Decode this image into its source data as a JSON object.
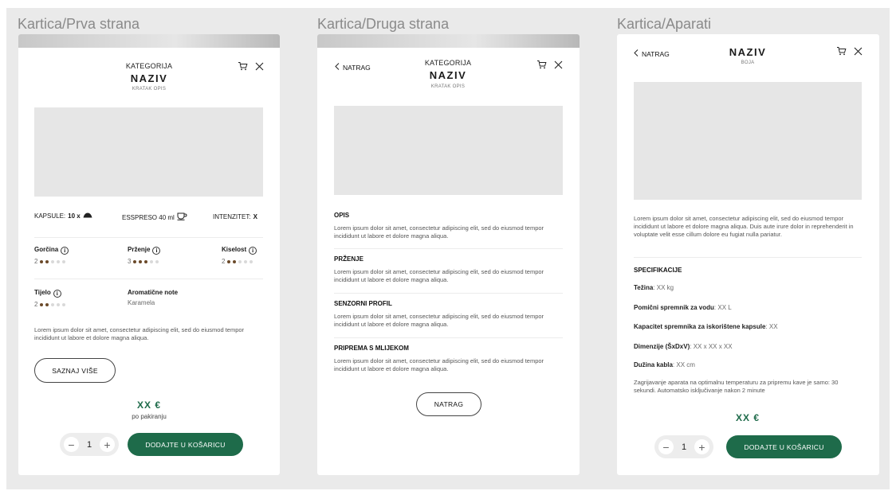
{
  "frames": {
    "prva": "Kartica/Prva strana",
    "druga": "Kartica/Druga strana",
    "aparati": "Kartica/Aparati"
  },
  "card1": {
    "kategorija": "KATEGORIJA",
    "naziv": "NAZIV",
    "kratak_opis": "KRATAK OPIS",
    "kapsule_label": "KAPSULE:",
    "kapsule_value": "10 x",
    "espreso": "ESSPRESO 40 ml",
    "intenzitet_label": "INTENZITET:",
    "intenzitet_value": "X",
    "gorcina": {
      "label": "Gorčina",
      "value": "2",
      "level": 2
    },
    "przenje": {
      "label": "Prženje",
      "value": "3",
      "level": 3
    },
    "kiselost": {
      "label": "Kiselost",
      "value": "2",
      "level": 2
    },
    "tijelo": {
      "label": "Tijelo",
      "value": "2",
      "level": 2
    },
    "aromaticne_label": "Aromatične note",
    "aromaticne_value": "Karamela",
    "description": "Lorem ipsum dolor sit amet, consectetur adipiscing elit, sed do eiusmod tempor incididunt ut labore et dolore magna aliqua.",
    "saznaj": "SAZNAJ VIŠE",
    "price": "XX €",
    "per": "po pakiranju",
    "qty": "1",
    "add": "DODAJTE U KOŠARICU"
  },
  "card2": {
    "back": "NATRAG",
    "kategorija": "KATEGORIJA",
    "naziv": "NAZIV",
    "kratak_opis": "KRATAK OPIS",
    "sections": [
      {
        "title": "OPIS",
        "text": "Lorem ipsum dolor sit amet, consectetur adipiscing elit, sed do eiusmod tempor incididunt ut labore et dolore magna aliqua."
      },
      {
        "title": "PRŽENJE",
        "text": "Lorem ipsum dolor sit amet, consectetur adipiscing elit, sed do eiusmod tempor incididunt ut labore et dolore magna aliqua."
      },
      {
        "title": "SENZORNI PROFIL",
        "text": "Lorem ipsum dolor sit amet, consectetur adipiscing elit, sed do eiusmod tempor incididunt ut labore et dolore magna aliqua."
      },
      {
        "title": "PRIPREMA S MLIJEKOM",
        "text": "Lorem ipsum dolor sit amet, consectetur adipiscing elit, sed do eiusmod tempor incididunt ut labore et dolore magna aliqua."
      }
    ],
    "natrag_button": "NATRAG"
  },
  "card3": {
    "back": "NATRAG",
    "naziv": "NAZIV",
    "boja": "BOJA",
    "description": "Lorem ipsum dolor sit amet, consectetur adipiscing elit, sed do eiusmod tempor incididunt ut labore et dolore magna aliqua. Duis aute irure dolor in reprehenderit in voluptate velit esse cillum dolore eu fugiat nulla pariatur.",
    "spec_title": "SPECIFIKACIJE",
    "specs": [
      {
        "label": "Težina",
        "value": ": XX kg"
      },
      {
        "label": "Pomični spremnik za vodu",
        "value": ": XX L"
      },
      {
        "label": "Kapacitet spremnika za iskorištene kapsule",
        "value": ": XX"
      },
      {
        "label": "Dimenzije (ŠxDxV)",
        "value": ": XX x XX x XX"
      },
      {
        "label": "Dužina kabla",
        "value": ": XX cm"
      }
    ],
    "note": "Zagrijavanje aparata na optimalnu temperaturu za pripremu kave je samo: 30 sekundi. Automatsko isključivanje nakon 2 minute",
    "price": "XX €",
    "qty": "1",
    "add": "DODAJTE U KOŠARICU"
  },
  "icons": [
    "cart-icon",
    "close-icon",
    "chevron-left-icon",
    "info-icon",
    "capsule-icon",
    "cup-icon",
    "minus-icon",
    "plus-icon"
  ],
  "colors": {
    "accent": "#1e6b4a",
    "dot_on": "#6b4a2a",
    "dot_off": "#d9d9d9",
    "placeholder": "#e6e6e6",
    "canvas": "#eaeaea"
  }
}
